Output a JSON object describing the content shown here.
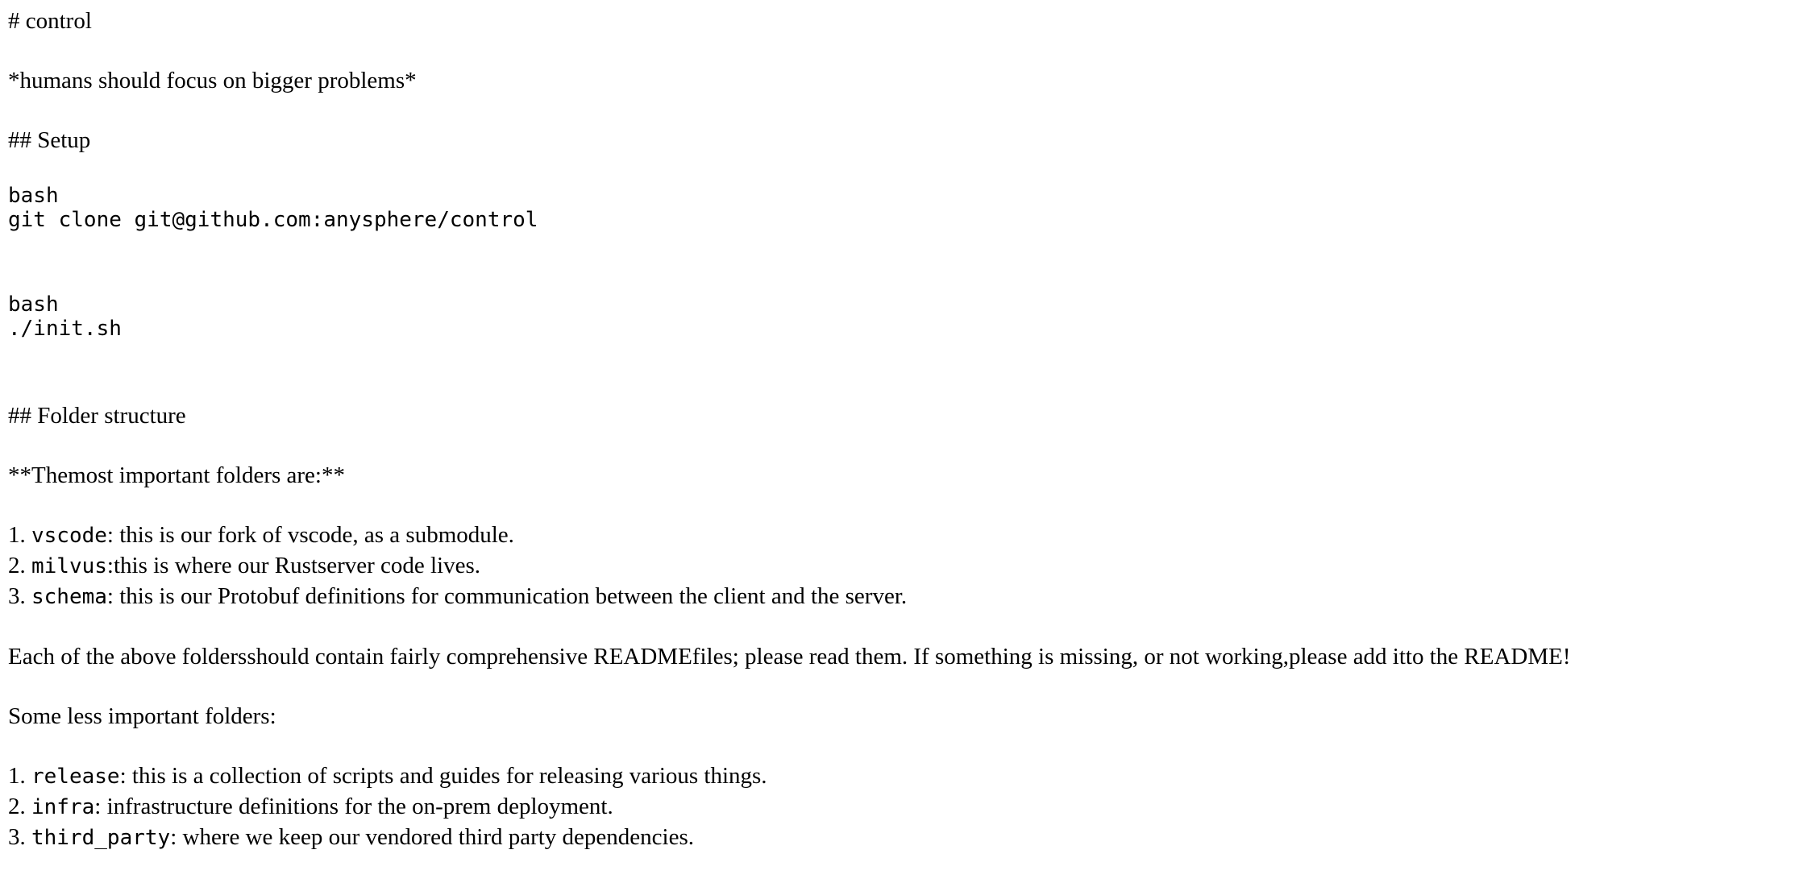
{
  "doc": {
    "h1": "# control",
    "tagline": "*humans should focus on bigger problems*",
    "setup_heading": "## Setup",
    "code_blocks": [
      {
        "lang": "bash",
        "cmd": "git clone git@github.com:anysphere/control"
      },
      {
        "lang": "bash",
        "cmd": "./init.sh"
      }
    ],
    "folder_heading": "## Folder structure",
    "important_intro": "**Themost important folders are:**",
    "important_list": [
      {
        "num": "1.",
        "code": "vscode",
        "text": ": this is our fork of vscode, as a submodule."
      },
      {
        "num": "2.",
        "code": "milvus",
        "text": ":this is where our Rustserver code lives."
      },
      {
        "num": "3.",
        "code": "schema",
        "text": ": this is our Protobuf definitions for communication between the client and the server."
      }
    ],
    "readme_note": "Each of the above foldersshould contain fairly comprehensive READMEfiles; please read them. If something is missing, or not working,please add itto the README!",
    "less_intro": "Some less important folders:",
    "less_list": [
      {
        "num": "1.",
        "code": "release",
        "text": ": this is a collection of scripts and guides for releasing various things."
      },
      {
        "num": "2.",
        "code": "infra",
        "text": ": infrastructure definitions for the on-prem deployment."
      },
      {
        "num": "3.",
        "code": "third_party",
        "text": ": where we keep our vendored third party dependencies."
      }
    ]
  }
}
